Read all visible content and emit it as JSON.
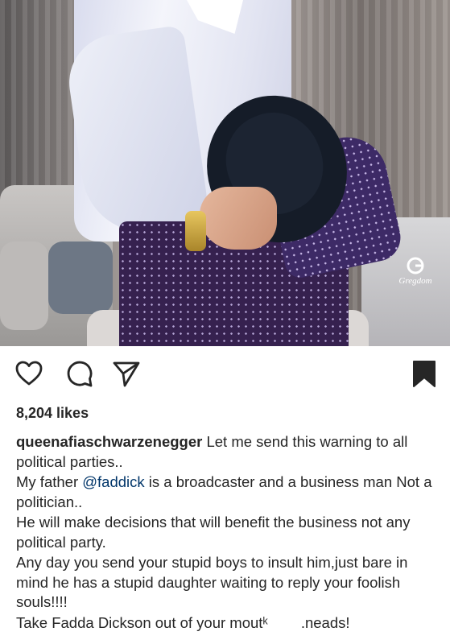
{
  "photo": {
    "alt": "Man in white shirt and purple polka-dot trousers holding a black hat",
    "watermark_text": "Gregdom"
  },
  "actions": {
    "like_icon": "heart-icon",
    "comment_icon": "comment-icon",
    "share_icon": "paper-plane-icon",
    "save_icon": "bookmark-icon"
  },
  "post": {
    "likes": "8,204 likes",
    "username": "queenafiaschwarzenegger",
    "caption_lines": [
      " Let me send this warning to all political parties..",
      "My father ",
      "@faddick",
      " is a broadcaster and a business man Not a politician..",
      "He will make decisions that will benefit the business not any political party.",
      "Any day  you send your stupid boys to insult him,just bare in mind he has a stupid daughter waiting to reply your foolish souls!!!!",
      "Take Fadda Dickson out of your moutᵏ        .neads!"
    ]
  },
  "colors": {
    "text": "#262626",
    "mention": "#003569",
    "background": "#ffffff"
  }
}
